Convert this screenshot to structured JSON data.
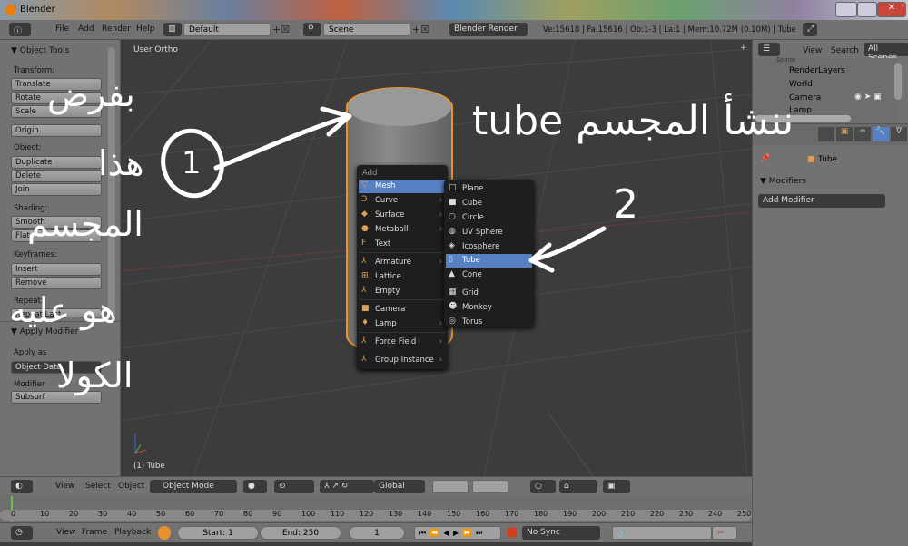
{
  "window": {
    "title": "Blender"
  },
  "info_header": {
    "menus": [
      "File",
      "Add",
      "Render",
      "Help"
    ],
    "layout": "Default",
    "scene": "Scene",
    "engine": "Blender Render",
    "stats": "Ve:15618 | Fa:15616 | Ob:1-3 | La:1 | Mem:10.72M (0.10M) | Tube"
  },
  "tool_panel": {
    "title": "Object Tools",
    "transform_label": "Transform:",
    "transform": [
      "Translate",
      "Rotate",
      "Scale"
    ],
    "origin": "Origin",
    "object_label": "Object:",
    "object": [
      "Duplicate",
      "Delete",
      "Join"
    ],
    "shading_label": "Shading:",
    "shading": [
      "Smooth",
      "Flat"
    ],
    "keyframes_label": "Keyframes:",
    "keyframes": [
      "Insert",
      "Remove"
    ],
    "repeat_label": "Repeat:",
    "repeat_last": "Repeat Last",
    "apply_title": "Apply Modifier",
    "apply_as_label": "Apply as",
    "apply_as": "Object Data",
    "modifier_label": "Modifier",
    "modifier": "Subsurf"
  },
  "viewport": {
    "view_name": "User Ortho",
    "object_label": "(1) Tube"
  },
  "add_menu": {
    "title": "Add",
    "items": [
      {
        "label": "Mesh",
        "icon": "mesh-icon",
        "sub": true
      },
      {
        "label": "Curve",
        "icon": "curve-icon",
        "sub": true
      },
      {
        "label": "Surface",
        "icon": "surface-icon",
        "sub": true
      },
      {
        "label": "Metaball",
        "icon": "metaball-icon",
        "sub": true
      },
      {
        "label": "Text",
        "icon": "text-icon",
        "sub": false
      },
      {
        "label": "Armature",
        "icon": "armature-icon",
        "sub": true
      },
      {
        "label": "Lattice",
        "icon": "lattice-icon",
        "sub": false
      },
      {
        "label": "Empty",
        "icon": "empty-icon",
        "sub": false
      },
      {
        "label": "Camera",
        "icon": "camera-icon",
        "sub": false
      },
      {
        "label": "Lamp",
        "icon": "lamp-icon",
        "sub": true
      },
      {
        "label": "Force Field",
        "icon": "force-field-icon",
        "sub": true
      },
      {
        "label": "Group Instance",
        "icon": "group-instance-icon",
        "sub": true
      }
    ]
  },
  "mesh_menu": {
    "items": [
      "Plane",
      "Cube",
      "Circle",
      "UV Sphere",
      "Icosphere",
      "Tube",
      "Cone",
      "Grid",
      "Monkey",
      "Torus"
    ],
    "selected": "Tube"
  },
  "outliner": {
    "menus": [
      "View",
      "Search"
    ],
    "filter": "All Scenes",
    "items": [
      "Scene",
      "RenderLayers",
      "World",
      "Camera",
      "Lamp"
    ]
  },
  "properties": {
    "object": "Tube",
    "panel": "Modifiers",
    "add_modifier": "Add Modifier"
  },
  "view3d_header": {
    "menus": [
      "View",
      "Select",
      "Object"
    ],
    "mode": "Object Mode",
    "orientation": "Global"
  },
  "timeline": {
    "ticks": [
      "0",
      "10",
      "20",
      "30",
      "40",
      "50",
      "60",
      "70",
      "80",
      "90",
      "100",
      "110",
      "120",
      "130",
      "140",
      "150",
      "160",
      "170",
      "180",
      "190",
      "200",
      "210",
      "220",
      "230",
      "240",
      "250"
    ],
    "menus": [
      "View",
      "Frame",
      "Playback"
    ],
    "start": "Start: 1",
    "end": "End: 250",
    "current": "1",
    "sync": "No Sync"
  },
  "annotations": {
    "left_lines": [
      "بفرض",
      "هذا",
      "المجسم",
      "هو عليه",
      "الكولا"
    ],
    "right": "ننشأ المجسم tube",
    "num1": "1",
    "num2": "2"
  },
  "colors": {
    "selection": "#5680c2",
    "outline": "#f0922a",
    "viewport": "#3c3c3c"
  }
}
